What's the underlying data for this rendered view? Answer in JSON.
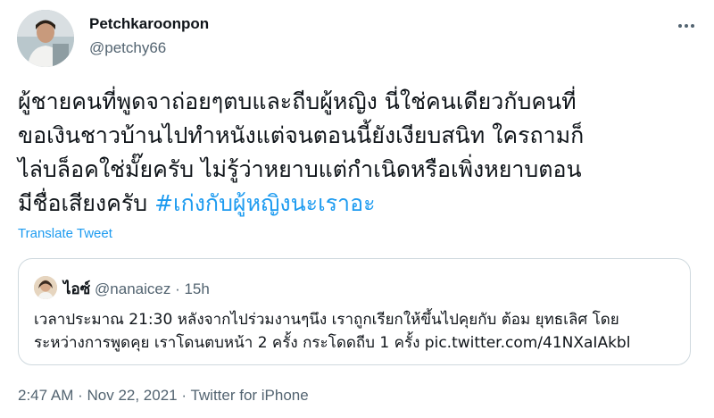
{
  "author": {
    "display_name": "Petchkaroonpon",
    "handle": "@petchy66"
  },
  "more_icon": "ellipsis-icon",
  "tweet": {
    "lines": [
      "ผู้ชายคนที่พูดจาถ่อยๆตบและถีบผู้หญิง นี่ใช่คนเดียวกับคนที่",
      "ขอเงินชาวบ้านไปทำหนังแต่จนตอนนี้ยังเงียบสนิท ใครถามก็",
      "ไล่บล็อคใช่มั๊ยครับ ไม่รู้ว่าหยาบแต่กำเนิดหรือเพิ่งหยาบตอน"
    ],
    "last_line_text": "มีชื่อเสียงครับ ",
    "hashtag": "#เก่งกับผู้หญิงนะเราอะ"
  },
  "translate_label": "Translate Tweet",
  "quote": {
    "display_name": "ไอซ์",
    "handle": "@nanaicez",
    "separator": " · ",
    "time": "15h",
    "lines": [
      "เวลาประมาณ 21:30 หลังจากไปร่วมงานๆนึง เราถูกเรียกให้ขึ้นไปคุยกับ ต้อม ยุทธเลิศ โดย",
      "ระหว่างการพูดคุย เราโดนตบหน้า 2 ครั้ง กระโดดถีบ 1 ครั้ง pic.twitter.com/41NXaIAkbl"
    ]
  },
  "footer": {
    "time": "2:47 AM",
    "sep1": " · ",
    "date": "Nov 22, 2021",
    "sep2": " · ",
    "source": "Twitter for iPhone"
  },
  "colors": {
    "link": "#1d9bf0",
    "secondary_text": "#536471",
    "border": "#cfd9de"
  }
}
